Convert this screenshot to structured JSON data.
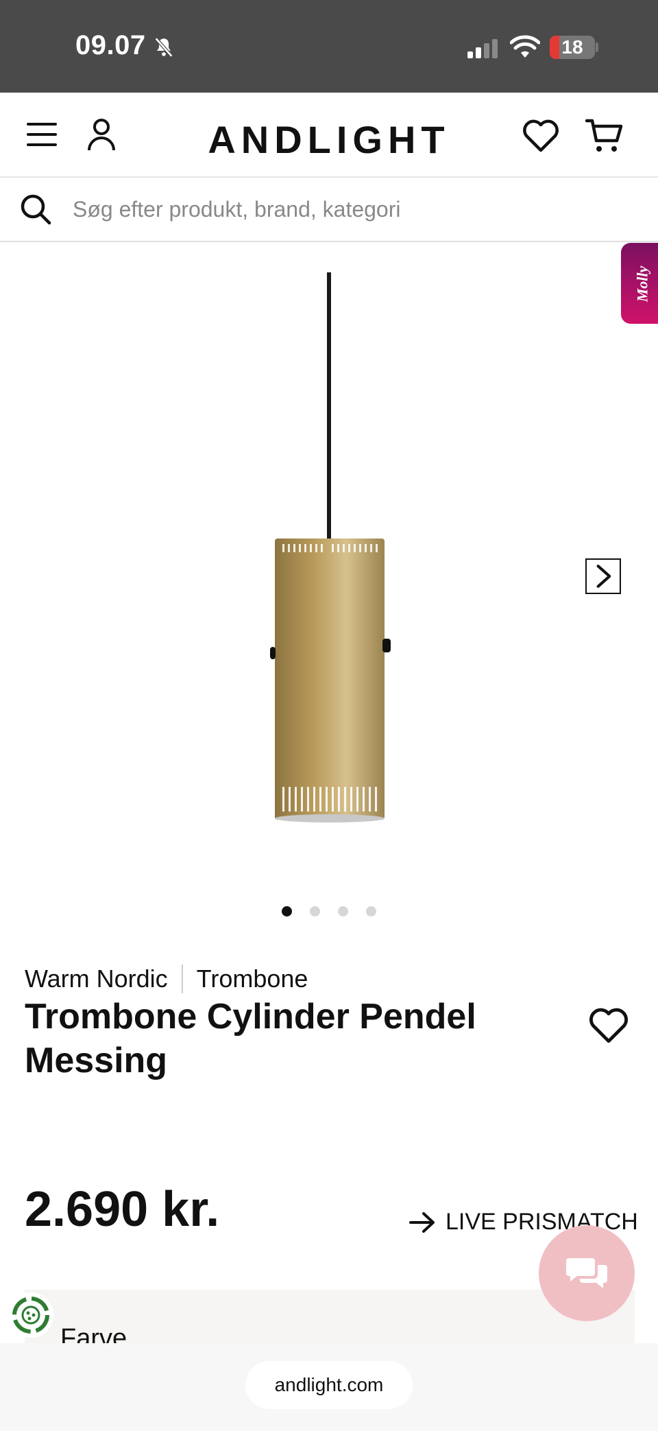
{
  "status_bar": {
    "time": "09.07",
    "battery": "18"
  },
  "header": {
    "logo": "ANDLIGHT"
  },
  "search": {
    "placeholder": "Søg efter produkt, brand, kategori"
  },
  "molly_tab": {
    "label": "Molly"
  },
  "gallery": {
    "total_images": 4,
    "active_index": 0
  },
  "product": {
    "brand": "Warm Nordic",
    "series": "Trombone",
    "title": "Trombone Cylinder Pendel Messing",
    "price": "2.690 kr.",
    "price_match_label": "LIVE PRISMATCH"
  },
  "options": {
    "color_label": "Farve"
  },
  "browser": {
    "url": "andlight.com"
  },
  "colors": {
    "accent_molly": "#b0126a",
    "chat_button": "#f0bfc4",
    "brass": "#b89a5a"
  }
}
